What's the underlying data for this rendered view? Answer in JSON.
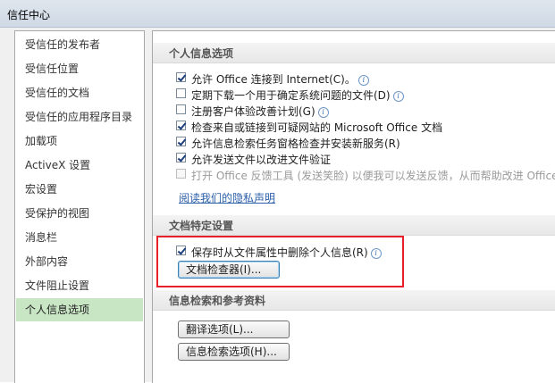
{
  "window": {
    "title": "信任中心"
  },
  "sidebar": {
    "items": [
      {
        "label": "受信任的发布者"
      },
      {
        "label": "受信任位置"
      },
      {
        "label": "受信任的文档"
      },
      {
        "label": "受信任的应用程序目录"
      },
      {
        "label": "加载项"
      },
      {
        "label": "ActiveX 设置"
      },
      {
        "label": "宏设置"
      },
      {
        "label": "受保护的视图"
      },
      {
        "label": "消息栏"
      },
      {
        "label": "外部内容"
      },
      {
        "label": "文件阻止设置"
      },
      {
        "label": "个人信息选项",
        "selected": true
      }
    ]
  },
  "privacy": {
    "heading": "个人信息选项",
    "options": [
      {
        "label": "允许 Office 连接到 Internet(C)。",
        "checked": true
      },
      {
        "label": "定期下载一个用于确定系统问题的文件(D)",
        "checked": false
      },
      {
        "label": "注册客户体验改善计划(G)",
        "checked": false
      },
      {
        "label": "检查来自或链接到可疑网站的 Microsoft Office 文档",
        "checked": true
      },
      {
        "label": "允许信息检索任务窗格检查并安装新服务(R)",
        "checked": true
      },
      {
        "label": "允许发送文件以改进文件验证",
        "checked": true
      },
      {
        "label": "打开 Office 反馈工具 (发送笑脸) 以便我可以发送反馈，从而帮助改进 Office",
        "checked": false,
        "disabled": true
      }
    ],
    "privacy_link": "阅读我们的隐私声明"
  },
  "doc_specific": {
    "heading": "文档特定设置",
    "remove_info_label": "保存时从文件属性中删除个人信息(R)",
    "remove_info_checked": true,
    "inspector_button": "文档检查器(I)..."
  },
  "research": {
    "heading": "信息检索和参考资料",
    "translate_button": "翻译选项(L)...",
    "research_button": "信息检索选项(H)..."
  },
  "colors": {
    "selected_nav": "#c8e5c4",
    "highlight_box": "#e8202a",
    "link": "#2a5ea8"
  }
}
